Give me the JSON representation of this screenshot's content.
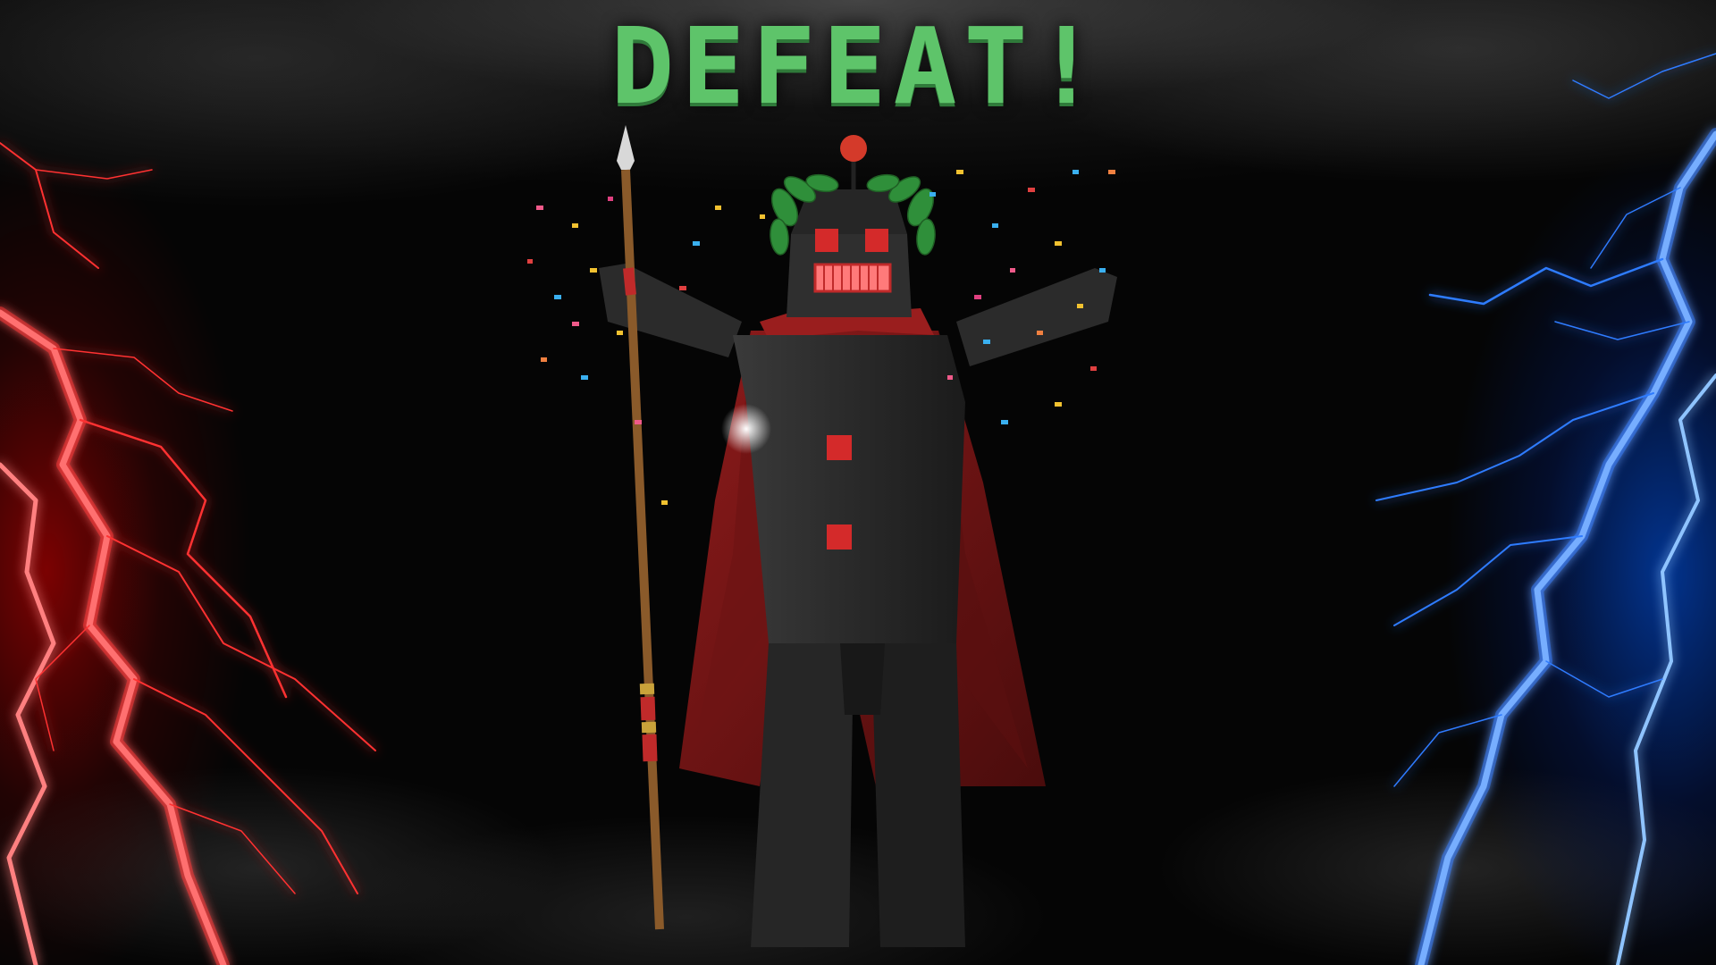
{
  "screen": {
    "title": "DEFEAT!",
    "title_color": "#5ec46a"
  },
  "scene": {
    "left_effect": "red-lightning",
    "right_effect": "blue-lightning",
    "character": "robot-emperor-with-spear",
    "accent_red": "#d42a2a",
    "accent_blue": "#2f7bff"
  }
}
